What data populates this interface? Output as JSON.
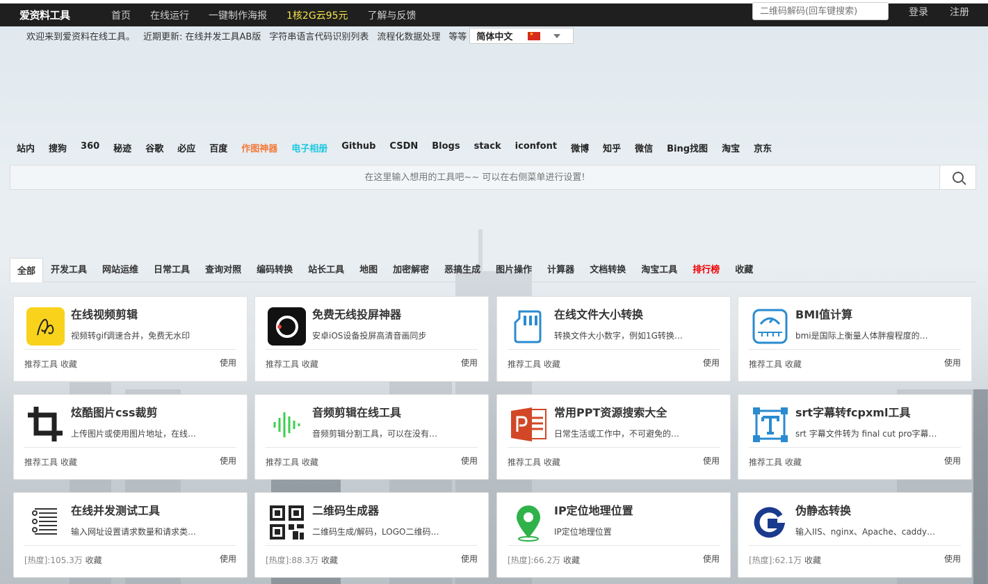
{
  "topbar": {
    "logo": "爱资料工具",
    "nav": [
      "首页",
      "在线运行",
      "一键制作海报",
      "1核2G云95元",
      "了解与反馈"
    ],
    "qr_placeholder": "二维码解码(回车键搜索)",
    "login": "登录",
    "register": "注册"
  },
  "welcome": {
    "parts": [
      "欢迎来到爱资料在线工具。",
      "近期更新: 在线并发工具AB版",
      "字符串语言代码识别列表",
      "流程化数据处理",
      "等等"
    ],
    "language": "简体中文"
  },
  "engines": [
    "站内",
    "搜狗",
    "360",
    "秘迹",
    "谷歌",
    "必应",
    "百度",
    "作图神器",
    "电子相册",
    "Github",
    "CSDN",
    "Blogs",
    "stack",
    "iconfont",
    "微博",
    "知乎",
    "微信",
    "Bing找图",
    "淘宝",
    "京东"
  ],
  "search": {
    "placeholder": "在这里输入想用的工具吧~~ 可以在右侧菜单进行设置!"
  },
  "tabs": [
    "全部",
    "开发工具",
    "网站运维",
    "日常工具",
    "查询对照",
    "编码转换",
    "站长工具",
    "地图",
    "加密解密",
    "恶搞生成",
    "图片操作",
    "计算器",
    "文档转换",
    "淘宝工具",
    "排行榜",
    "收藏"
  ],
  "cards": [
    {
      "title": "在线视频剪辑",
      "desc": "视频转gif调速合并，免费无水印",
      "foot": "推荐工具 收藏",
      "use": "使用",
      "icon": "video-edit-icon"
    },
    {
      "title": "免费无线投屏神器",
      "desc": "安卓iOS设备投屏高清音画同步",
      "foot": "推荐工具 收藏",
      "use": "使用",
      "icon": "screen-cast-icon"
    },
    {
      "title": "在线文件大小转换",
      "desc": "转换文件大小数字，例如1G转换…",
      "foot": "推荐工具 收藏",
      "use": "使用",
      "icon": "sd-card-icon"
    },
    {
      "title": "BMI值计算",
      "desc": "bmi是国际上衡量人体胖瘦程度的…",
      "foot": "推荐工具 收藏",
      "use": "使用",
      "icon": "scale-icon"
    },
    {
      "title": "炫酷图片css裁剪",
      "desc": "上传图片或使用图片地址，在线…",
      "foot": "推荐工具 收藏",
      "use": "使用",
      "icon": "crop-icon"
    },
    {
      "title": "音频剪辑在线工具",
      "desc": "音频剪辑分割工具，可以在没有…",
      "foot": "推荐工具 收藏",
      "use": "使用",
      "icon": "audio-wave-icon"
    },
    {
      "title": "常用PPT资源搜索大全",
      "desc": "日常生活或工作中，不可避免的…",
      "foot": "推荐工具 收藏",
      "use": "使用",
      "icon": "ppt-icon"
    },
    {
      "title": "srt字幕转fcpxml工具",
      "desc": "srt 字幕文件转为 final cut pro字幕…",
      "foot": "推荐工具 收藏",
      "use": "使用",
      "icon": "text-frame-icon"
    },
    {
      "title": "在线并发测试工具",
      "desc": "输入网址设置请求数量和请求类…",
      "heat": "[热度]:105.3万",
      "foot": "收藏",
      "use": "使用",
      "icon": "list-icon"
    },
    {
      "title": "二维码生成器",
      "desc": "二维码生成/解码，LOGO二维码…",
      "heat": "[热度]:88.3万",
      "foot": "收藏",
      "use": "使用",
      "icon": "qrcode-icon"
    },
    {
      "title": "IP定位地理位置",
      "desc": "IP定位地理位置",
      "heat": "[热度]:66.2万",
      "foot": "收藏",
      "use": "使用",
      "icon": "location-pin-icon"
    },
    {
      "title": "伪静态转换",
      "desc": "输入IIS、nginx、Apache、caddy…",
      "heat": "[热度]:62.1万",
      "foot": "收藏",
      "use": "使用",
      "icon": "g-logo-icon"
    }
  ],
  "colors": {
    "topbar": "#1f1f1f",
    "promo": "#f5e34a",
    "orange": "#f27a3a",
    "cyan": "#1ec8e0",
    "red": "#ee0000"
  }
}
